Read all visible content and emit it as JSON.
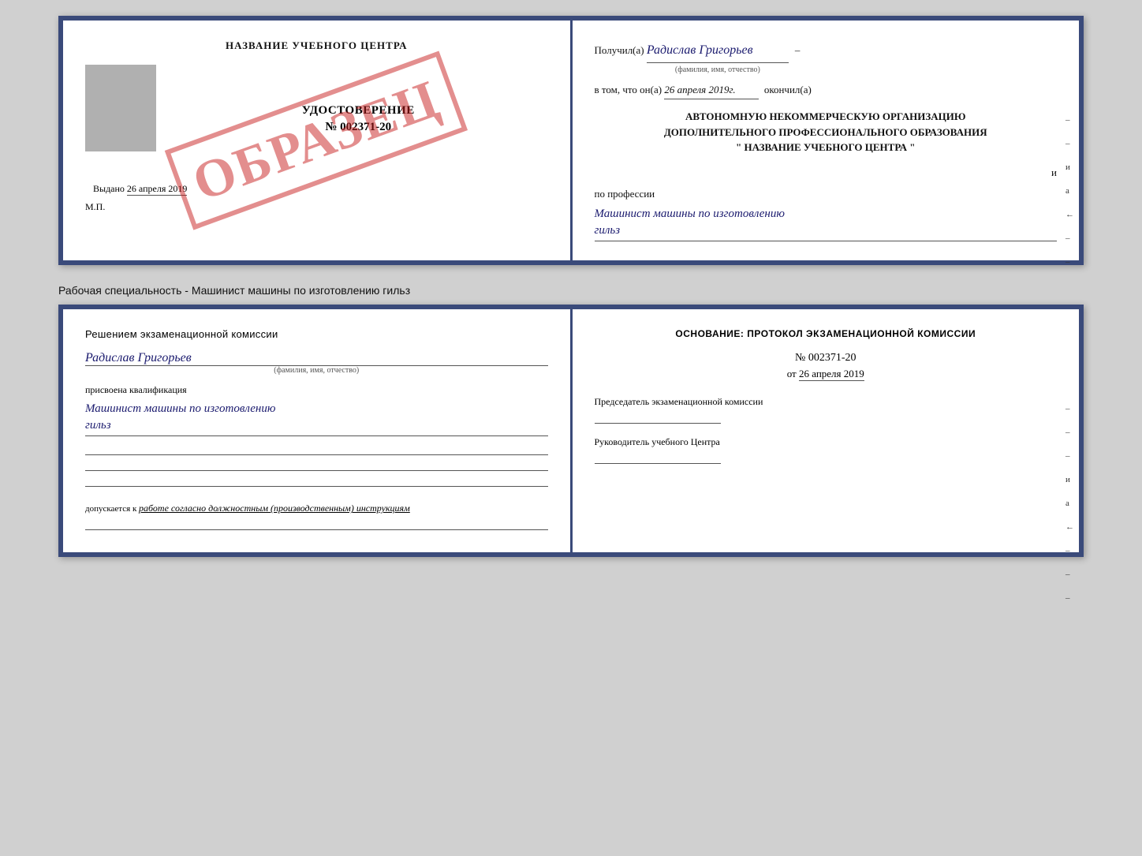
{
  "book1": {
    "left": {
      "header": "НАЗВАНИЕ УЧЕБНОГО ЦЕНТРА",
      "cert_title": "УДОСТОВЕРЕНИЕ",
      "cert_number": "№ 002371-20",
      "issued_label": "Выдано",
      "issued_date": "26 апреля 2019",
      "mp_label": "М.П.",
      "stamp_text": "ОБРАЗЕЦ"
    },
    "right": {
      "received_label": "Получил(а)",
      "received_value": "Радислав Григорьев",
      "received_sublabel": "(фамилия, имя, отчество)",
      "dash": "–",
      "in_that_label": "в том, что он(а)",
      "in_that_date": "26 апреля 2019г.",
      "finished_label": "окончил(а)",
      "org_line1": "АВТОНОМНУЮ НЕКОММЕРЧЕСКУЮ ОРГАНИЗАЦИЮ",
      "org_line2": "ДОПОЛНИТЕЛЬНОГО ПРОФЕССИОНАЛЬНОГО ОБРАЗОВАНИЯ",
      "org_quotes_open": "\"",
      "org_name": "НАЗВАНИЕ УЧЕБНОГО ЦЕНТРА",
      "org_quotes_close": "\"",
      "and_label": "и",
      "by_profession_label": "по профессии",
      "profession_value": "Машинист машины по изготовлению",
      "profession_value2": "гильз",
      "side_marks": [
        "-",
        "-",
        "и",
        "а",
        "←",
        "-",
        "-"
      ]
    }
  },
  "subtitle": "Рабочая специальность - Машинист машины по изготовлению гильз",
  "book2": {
    "left": {
      "decision_label": "Решением экзаменационной комиссии",
      "name_value": "Радислав Григорьев",
      "name_sublabel": "(фамилия, имя, отчество)",
      "assigned_label": "присвоена квалификация",
      "qualification_value": "Машинист машины по изготовлению",
      "qualification_value2": "гильз",
      "dopusk_label": "допускается к",
      "dopusk_value": "работе согласно должностным (производственным) инструкциям"
    },
    "right": {
      "basis_label": "Основание: протокол экзаменационной комиссии",
      "protocol_number": "№ 002371-20",
      "protocol_date_prefix": "от",
      "protocol_date": "26 апреля 2019",
      "chairman_label": "Председатель экзаменационной комиссии",
      "director_label": "Руководитель учебного Центра",
      "side_marks": [
        "-",
        "-",
        "-",
        "и",
        "а",
        "←",
        "-",
        "-",
        "-"
      ]
    }
  }
}
